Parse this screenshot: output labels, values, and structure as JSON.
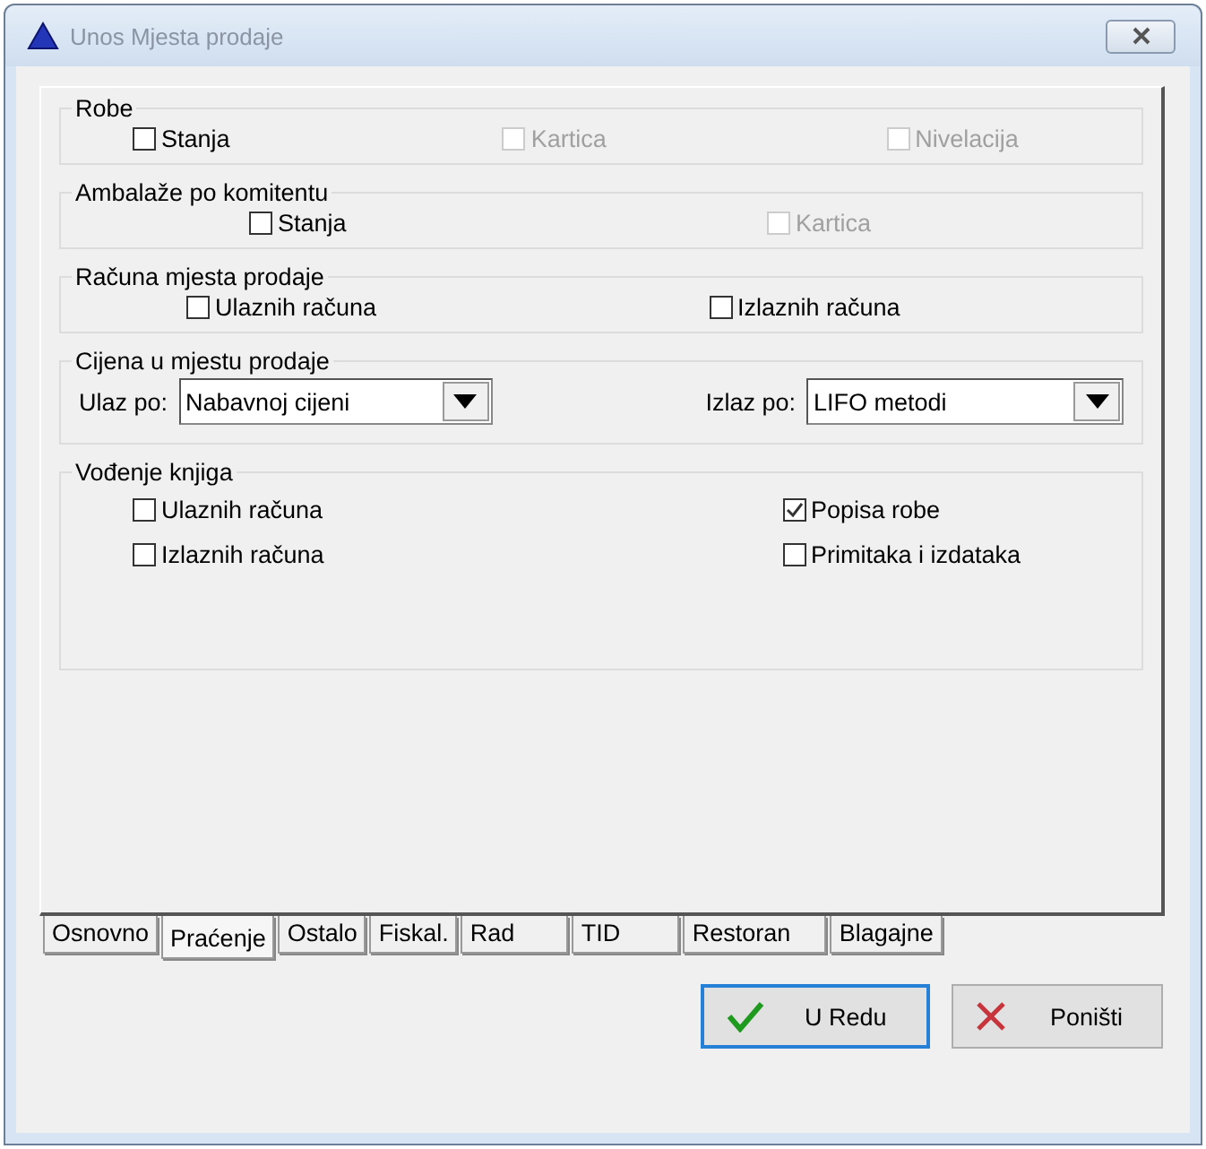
{
  "window": {
    "title": "Unos Mjesta prodaje"
  },
  "groups": [
    {
      "title": "Robe",
      "kind": "checkboxes",
      "items": [
        {
          "label": "Stanja",
          "checked": false,
          "disabled": false
        },
        {
          "label": "Kartica",
          "checked": false,
          "disabled": true
        },
        {
          "label": "Nivelacija",
          "checked": false,
          "disabled": true
        }
      ]
    },
    {
      "title": "Ambalaže po komitentu",
      "kind": "checkboxes",
      "items": [
        {
          "label": "Stanja",
          "checked": false,
          "disabled": false
        },
        {
          "label": "Kartica",
          "checked": false,
          "disabled": true
        }
      ]
    },
    {
      "title": "Računa mjesta prodaje",
      "kind": "checkboxes",
      "items": [
        {
          "label": "Ulaznih računa",
          "checked": false,
          "disabled": false
        },
        {
          "label": "Izlaznih računa",
          "checked": false,
          "disabled": false
        }
      ]
    },
    {
      "title": "Cijena u mjestu prodaje",
      "kind": "combos",
      "items": [
        {
          "label": "Ulaz po:",
          "value": "Nabavnoj cijeni"
        },
        {
          "label": "Izlaz po:",
          "value": "LIFO metodi"
        }
      ]
    },
    {
      "title": "Vođenje knjiga",
      "kind": "checkboxes",
      "items": [
        {
          "label": "Ulaznih računa",
          "checked": false,
          "disabled": false
        },
        {
          "label": "Popisa robe",
          "checked": true,
          "disabled": false
        },
        {
          "label": "Izlaznih računa",
          "checked": false,
          "disabled": false
        },
        {
          "label": "Primitaka i izdataka",
          "checked": false,
          "disabled": false
        }
      ]
    }
  ],
  "tabs": [
    {
      "label": "Osnovno",
      "selected": false
    },
    {
      "label": "Praćenje",
      "selected": true
    },
    {
      "label": "Ostalo",
      "selected": false
    },
    {
      "label": "Fiskal.",
      "selected": false
    },
    {
      "label": "Rad",
      "selected": false
    },
    {
      "label": "TID",
      "selected": false
    },
    {
      "label": "Restoran",
      "selected": false
    },
    {
      "label": "Blagajne",
      "selected": false
    }
  ],
  "buttons": [
    {
      "label": "U Redu",
      "kind": "ok"
    },
    {
      "label": "Poništi",
      "kind": "cancel"
    }
  ]
}
